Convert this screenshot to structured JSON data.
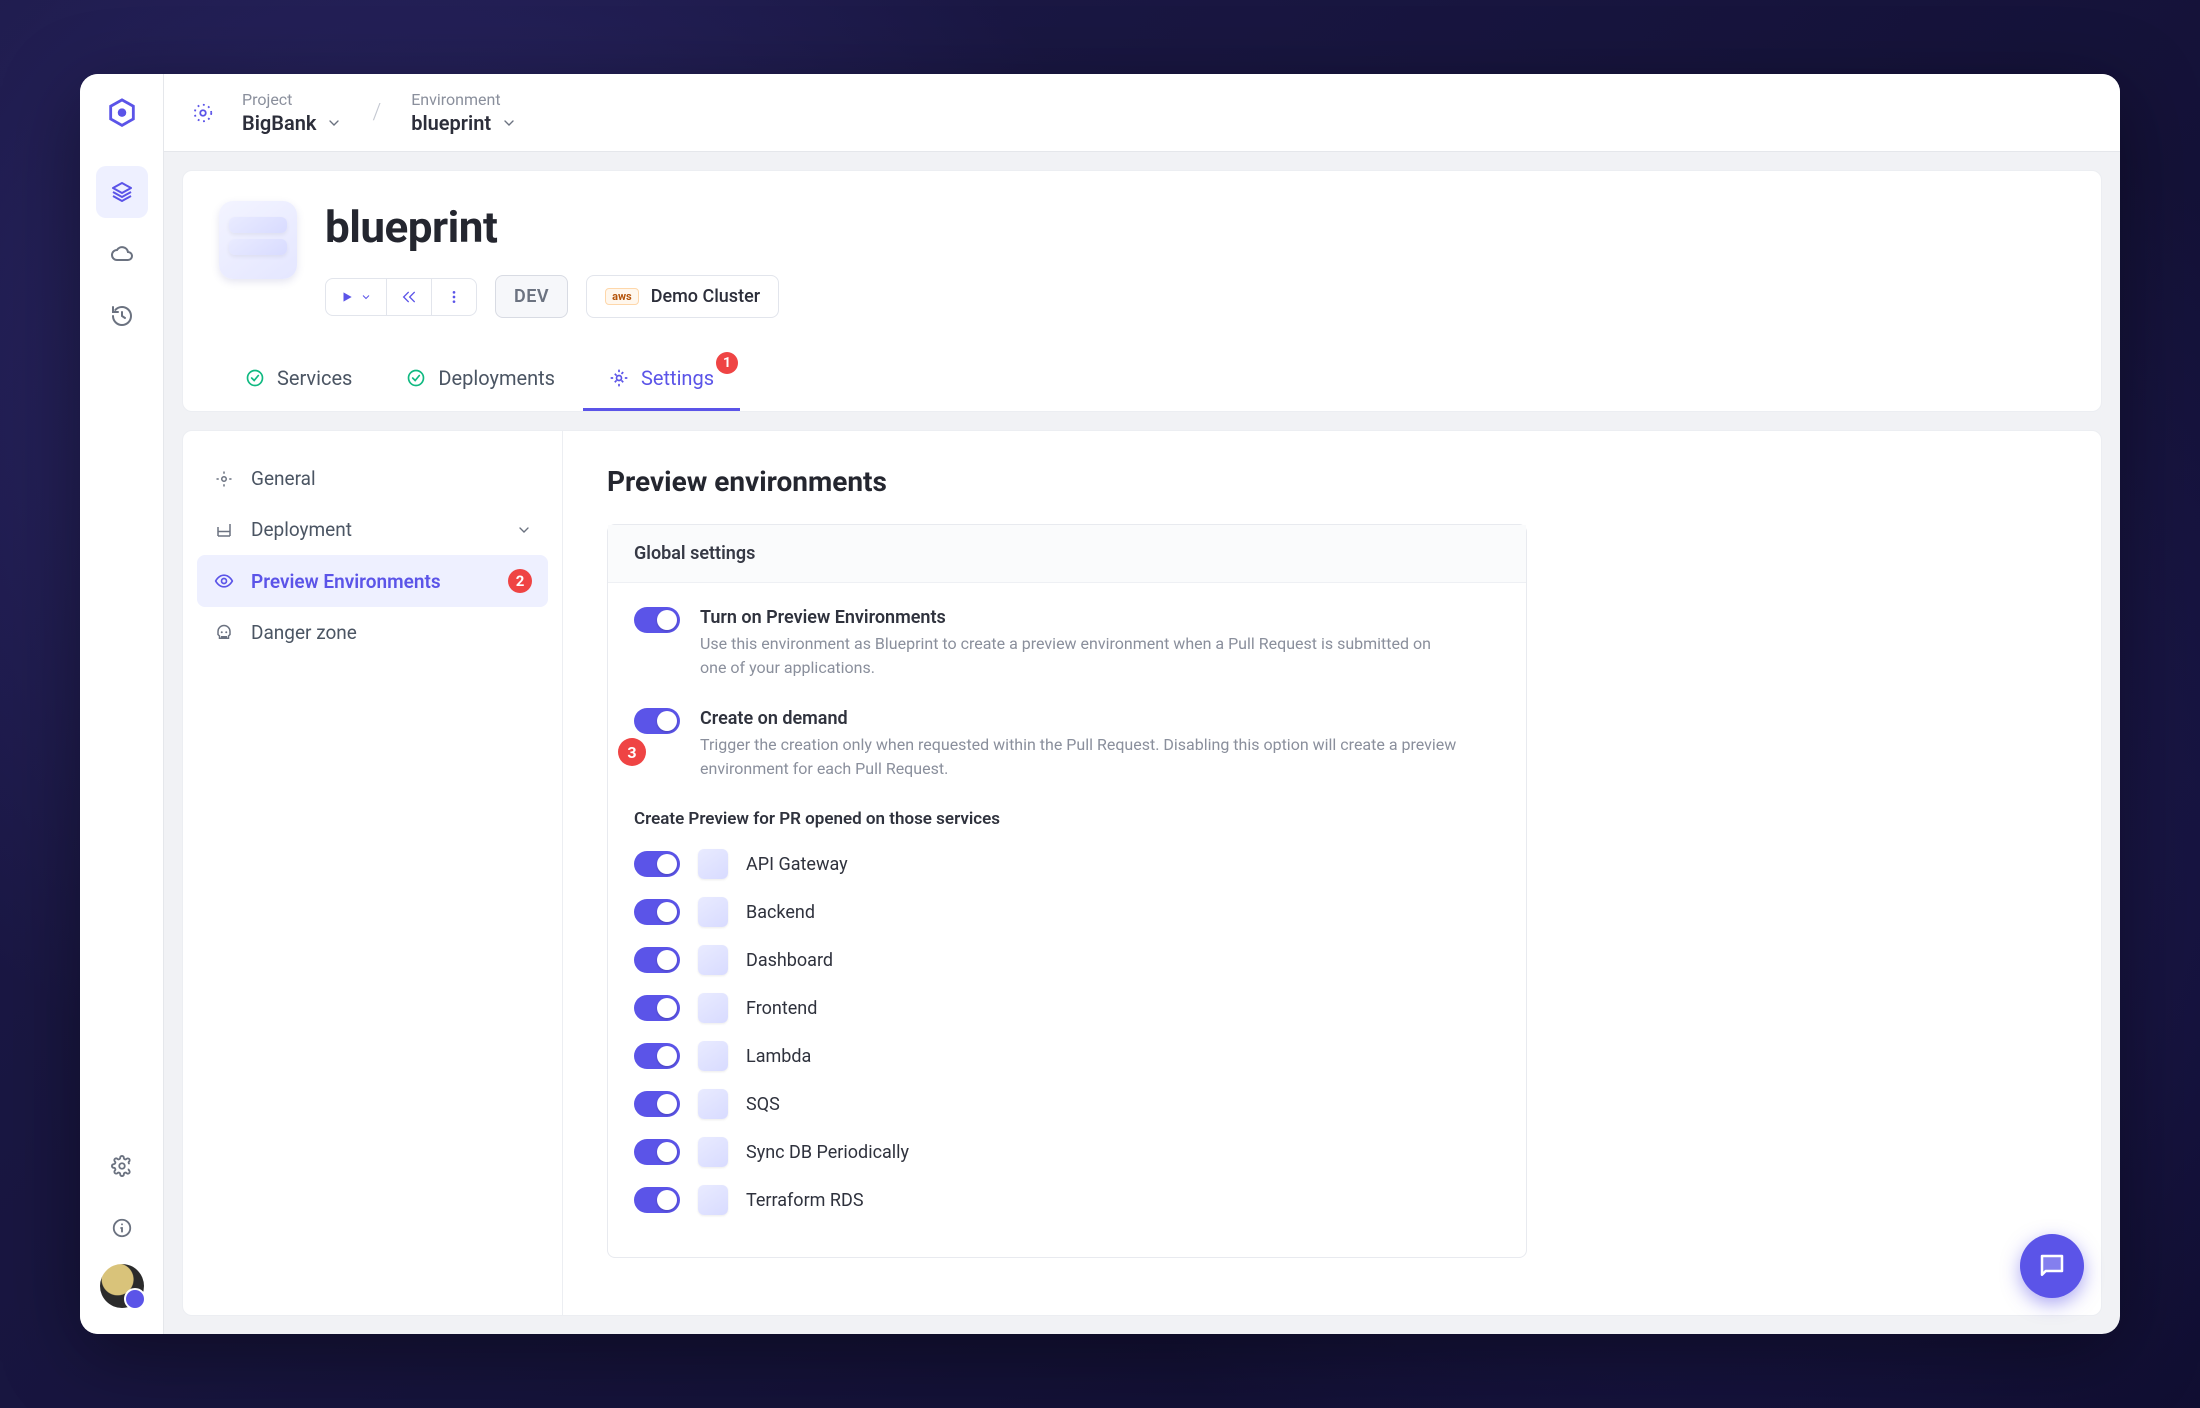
{
  "breadcrumb": {
    "project_label": "Project",
    "project_value": "BigBank",
    "env_label": "Environment",
    "env_value": "blueprint"
  },
  "header": {
    "title": "blueprint",
    "stage_pill": "DEV",
    "cluster_vendor": "aws",
    "cluster_name": "Demo Cluster"
  },
  "tabs": {
    "services": "Services",
    "deployments": "Deployments",
    "settings": "Settings",
    "settings_badge": "1"
  },
  "side": {
    "general": "General",
    "deployment": "Deployment",
    "preview": "Preview Environments",
    "preview_badge": "2",
    "danger": "Danger zone"
  },
  "page": {
    "title": "Preview environments",
    "global_section": "Global settings",
    "sw1_title": "Turn on Preview Environments",
    "sw1_desc": "Use this environment as Blueprint to create a preview environment when a Pull Request is submitted on one of your applications.",
    "sw2_title": "Create on demand",
    "sw2_desc": "Trigger the creation only when requested within the Pull Request. Disabling this option will create a preview environment for each Pull Request.",
    "step_3": "3",
    "svc_section": "Create Preview for PR opened on those services",
    "services": [
      "API Gateway",
      "Backend",
      "Dashboard",
      "Frontend",
      "Lambda",
      "SQS",
      "Sync DB Periodically",
      "Terraform RDS"
    ]
  }
}
